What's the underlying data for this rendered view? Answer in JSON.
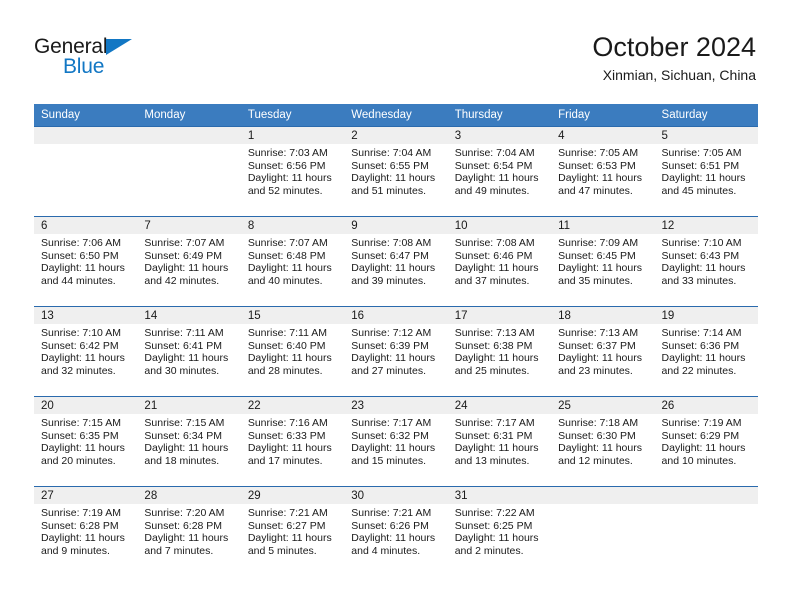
{
  "brand": {
    "logo_text_primary": "General",
    "logo_text_secondary": "Blue",
    "logo_accent_color": "#1277c4",
    "triangle_icon": "triangle-icon"
  },
  "header": {
    "title": "October 2024",
    "subtitle": "Xinmian, Sichuan, China"
  },
  "theme": {
    "header_blue": "#3b7cbf",
    "row_border_blue": "#2a6aad",
    "daynum_band_gray": "#efefef"
  },
  "weekday_headers": [
    "Sunday",
    "Monday",
    "Tuesday",
    "Wednesday",
    "Thursday",
    "Friday",
    "Saturday"
  ],
  "weeks": [
    [
      {
        "day": "",
        "sunrise": "",
        "sunset": "",
        "daylight_line1": "",
        "daylight_line2": "",
        "blank": true
      },
      {
        "day": "",
        "sunrise": "",
        "sunset": "",
        "daylight_line1": "",
        "daylight_line2": "",
        "blank": true
      },
      {
        "day": "1",
        "sunrise": "Sunrise: 7:03 AM",
        "sunset": "Sunset: 6:56 PM",
        "daylight_line1": "Daylight: 11 hours",
        "daylight_line2": "and 52 minutes."
      },
      {
        "day": "2",
        "sunrise": "Sunrise: 7:04 AM",
        "sunset": "Sunset: 6:55 PM",
        "daylight_line1": "Daylight: 11 hours",
        "daylight_line2": "and 51 minutes."
      },
      {
        "day": "3",
        "sunrise": "Sunrise: 7:04 AM",
        "sunset": "Sunset: 6:54 PM",
        "daylight_line1": "Daylight: 11 hours",
        "daylight_line2": "and 49 minutes."
      },
      {
        "day": "4",
        "sunrise": "Sunrise: 7:05 AM",
        "sunset": "Sunset: 6:53 PM",
        "daylight_line1": "Daylight: 11 hours",
        "daylight_line2": "and 47 minutes."
      },
      {
        "day": "5",
        "sunrise": "Sunrise: 7:05 AM",
        "sunset": "Sunset: 6:51 PM",
        "daylight_line1": "Daylight: 11 hours",
        "daylight_line2": "and 45 minutes."
      }
    ],
    [
      {
        "day": "6",
        "sunrise": "Sunrise: 7:06 AM",
        "sunset": "Sunset: 6:50 PM",
        "daylight_line1": "Daylight: 11 hours",
        "daylight_line2": "and 44 minutes."
      },
      {
        "day": "7",
        "sunrise": "Sunrise: 7:07 AM",
        "sunset": "Sunset: 6:49 PM",
        "daylight_line1": "Daylight: 11 hours",
        "daylight_line2": "and 42 minutes."
      },
      {
        "day": "8",
        "sunrise": "Sunrise: 7:07 AM",
        "sunset": "Sunset: 6:48 PM",
        "daylight_line1": "Daylight: 11 hours",
        "daylight_line2": "and 40 minutes."
      },
      {
        "day": "9",
        "sunrise": "Sunrise: 7:08 AM",
        "sunset": "Sunset: 6:47 PM",
        "daylight_line1": "Daylight: 11 hours",
        "daylight_line2": "and 39 minutes."
      },
      {
        "day": "10",
        "sunrise": "Sunrise: 7:08 AM",
        "sunset": "Sunset: 6:46 PM",
        "daylight_line1": "Daylight: 11 hours",
        "daylight_line2": "and 37 minutes."
      },
      {
        "day": "11",
        "sunrise": "Sunrise: 7:09 AM",
        "sunset": "Sunset: 6:45 PM",
        "daylight_line1": "Daylight: 11 hours",
        "daylight_line2": "and 35 minutes."
      },
      {
        "day": "12",
        "sunrise": "Sunrise: 7:10 AM",
        "sunset": "Sunset: 6:43 PM",
        "daylight_line1": "Daylight: 11 hours",
        "daylight_line2": "and 33 minutes."
      }
    ],
    [
      {
        "day": "13",
        "sunrise": "Sunrise: 7:10 AM",
        "sunset": "Sunset: 6:42 PM",
        "daylight_line1": "Daylight: 11 hours",
        "daylight_line2": "and 32 minutes."
      },
      {
        "day": "14",
        "sunrise": "Sunrise: 7:11 AM",
        "sunset": "Sunset: 6:41 PM",
        "daylight_line1": "Daylight: 11 hours",
        "daylight_line2": "and 30 minutes."
      },
      {
        "day": "15",
        "sunrise": "Sunrise: 7:11 AM",
        "sunset": "Sunset: 6:40 PM",
        "daylight_line1": "Daylight: 11 hours",
        "daylight_line2": "and 28 minutes."
      },
      {
        "day": "16",
        "sunrise": "Sunrise: 7:12 AM",
        "sunset": "Sunset: 6:39 PM",
        "daylight_line1": "Daylight: 11 hours",
        "daylight_line2": "and 27 minutes."
      },
      {
        "day": "17",
        "sunrise": "Sunrise: 7:13 AM",
        "sunset": "Sunset: 6:38 PM",
        "daylight_line1": "Daylight: 11 hours",
        "daylight_line2": "and 25 minutes."
      },
      {
        "day": "18",
        "sunrise": "Sunrise: 7:13 AM",
        "sunset": "Sunset: 6:37 PM",
        "daylight_line1": "Daylight: 11 hours",
        "daylight_line2": "and 23 minutes."
      },
      {
        "day": "19",
        "sunrise": "Sunrise: 7:14 AM",
        "sunset": "Sunset: 6:36 PM",
        "daylight_line1": "Daylight: 11 hours",
        "daylight_line2": "and 22 minutes."
      }
    ],
    [
      {
        "day": "20",
        "sunrise": "Sunrise: 7:15 AM",
        "sunset": "Sunset: 6:35 PM",
        "daylight_line1": "Daylight: 11 hours",
        "daylight_line2": "and 20 minutes."
      },
      {
        "day": "21",
        "sunrise": "Sunrise: 7:15 AM",
        "sunset": "Sunset: 6:34 PM",
        "daylight_line1": "Daylight: 11 hours",
        "daylight_line2": "and 18 minutes."
      },
      {
        "day": "22",
        "sunrise": "Sunrise: 7:16 AM",
        "sunset": "Sunset: 6:33 PM",
        "daylight_line1": "Daylight: 11 hours",
        "daylight_line2": "and 17 minutes."
      },
      {
        "day": "23",
        "sunrise": "Sunrise: 7:17 AM",
        "sunset": "Sunset: 6:32 PM",
        "daylight_line1": "Daylight: 11 hours",
        "daylight_line2": "and 15 minutes."
      },
      {
        "day": "24",
        "sunrise": "Sunrise: 7:17 AM",
        "sunset": "Sunset: 6:31 PM",
        "daylight_line1": "Daylight: 11 hours",
        "daylight_line2": "and 13 minutes."
      },
      {
        "day": "25",
        "sunrise": "Sunrise: 7:18 AM",
        "sunset": "Sunset: 6:30 PM",
        "daylight_line1": "Daylight: 11 hours",
        "daylight_line2": "and 12 minutes."
      },
      {
        "day": "26",
        "sunrise": "Sunrise: 7:19 AM",
        "sunset": "Sunset: 6:29 PM",
        "daylight_line1": "Daylight: 11 hours",
        "daylight_line2": "and 10 minutes."
      }
    ],
    [
      {
        "day": "27",
        "sunrise": "Sunrise: 7:19 AM",
        "sunset": "Sunset: 6:28 PM",
        "daylight_line1": "Daylight: 11 hours",
        "daylight_line2": "and 9 minutes."
      },
      {
        "day": "28",
        "sunrise": "Sunrise: 7:20 AM",
        "sunset": "Sunset: 6:28 PM",
        "daylight_line1": "Daylight: 11 hours",
        "daylight_line2": "and 7 minutes."
      },
      {
        "day": "29",
        "sunrise": "Sunrise: 7:21 AM",
        "sunset": "Sunset: 6:27 PM",
        "daylight_line1": "Daylight: 11 hours",
        "daylight_line2": "and 5 minutes."
      },
      {
        "day": "30",
        "sunrise": "Sunrise: 7:21 AM",
        "sunset": "Sunset: 6:26 PM",
        "daylight_line1": "Daylight: 11 hours",
        "daylight_line2": "and 4 minutes."
      },
      {
        "day": "31",
        "sunrise": "Sunrise: 7:22 AM",
        "sunset": "Sunset: 6:25 PM",
        "daylight_line1": "Daylight: 11 hours",
        "daylight_line2": "and 2 minutes."
      },
      {
        "day": "",
        "sunrise": "",
        "sunset": "",
        "daylight_line1": "",
        "daylight_line2": "",
        "blank": true
      },
      {
        "day": "",
        "sunrise": "",
        "sunset": "",
        "daylight_line1": "",
        "daylight_line2": "",
        "blank": true
      }
    ]
  ]
}
